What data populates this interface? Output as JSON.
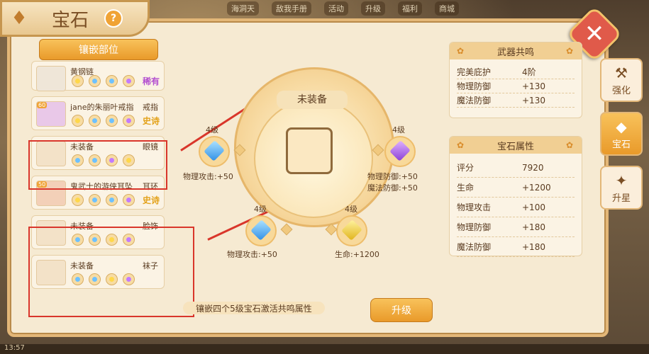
{
  "top_hud": [
    "海洞天",
    "敌我手册",
    "活动",
    "升级",
    "福利",
    "商城"
  ],
  "window": {
    "title": "宝石",
    "help": "?",
    "close": "✕"
  },
  "slots": {
    "header": "镶嵌部位",
    "items": [
      {
        "name": "黄钢链",
        "type": "",
        "rarity": "稀有",
        "gems": [
          "yellow",
          "blue",
          "blue",
          "purple"
        ]
      },
      {
        "name": "jane的朱丽叶戒指",
        "type": "戒指",
        "rarity": "史诗",
        "level": "60",
        "gems": [
          "yellow",
          "blue",
          "blue",
          "purple"
        ]
      },
      {
        "name": "未装备",
        "type": "眼镜",
        "rarity": "",
        "gems": [
          "blue",
          "blue",
          "purple",
          "yellow"
        ]
      },
      {
        "name": "鬼武士的游侠耳坠",
        "type": "耳环",
        "rarity": "史诗",
        "level": "50",
        "gems": [
          "yellow",
          "blue",
          "blue",
          "purple"
        ]
      },
      {
        "name": "未装备",
        "type": "脸饰",
        "rarity": "",
        "gems": [
          "blue",
          "blue",
          "yellow",
          "purple"
        ]
      },
      {
        "name": "未装备",
        "type": "袜子",
        "rarity": "",
        "gems": [
          "blue",
          "blue",
          "yellow",
          "purple"
        ]
      }
    ]
  },
  "center": {
    "label": "未装备",
    "nodes": [
      {
        "level": "4级",
        "attr": "物理攻击:+50",
        "gem": "blue"
      },
      {
        "level": "4级",
        "attr": "物理防御:+50",
        "attr2": "魔法防御:+50",
        "gem": "purple"
      },
      {
        "level": "4级",
        "attr": "物理攻击:+50",
        "gem": "blue"
      },
      {
        "level": "4级",
        "attr": "生命:+1200",
        "gem": "yellow"
      }
    ],
    "resonance_note": "镶嵌四个5级宝石激活共鸣属性",
    "upgrade": "升级"
  },
  "weapon_resonance": {
    "title": "武器共鸣",
    "rows": [
      {
        "k": "完美庇护",
        "v": "4阶"
      },
      {
        "k": "物理防御",
        "v": "+130"
      },
      {
        "k": "魔法防御",
        "v": "+130"
      }
    ]
  },
  "gem_attributes": {
    "title": "宝石属性",
    "rows": [
      {
        "k": "评分",
        "v": "7920"
      },
      {
        "k": "生命",
        "v": "+1200"
      },
      {
        "k": "物理攻击",
        "v": "+100"
      },
      {
        "k": "物理防御",
        "v": "+180"
      },
      {
        "k": "魔法防御",
        "v": "+180"
      }
    ]
  },
  "side_tabs": [
    {
      "label": "强化",
      "icon": "anvil-icon",
      "active": false
    },
    {
      "label": "宝石",
      "icon": "gem-icon",
      "active": true
    },
    {
      "label": "升星",
      "icon": "star-altar-icon",
      "active": false
    }
  ],
  "status_bar": {
    "time": "13:57"
  }
}
